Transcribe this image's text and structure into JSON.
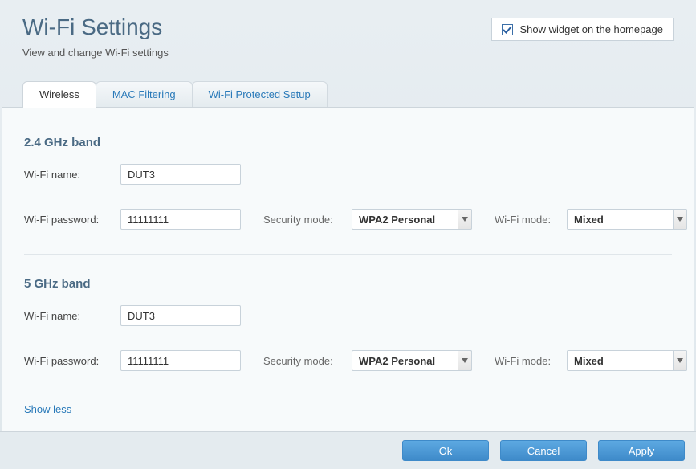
{
  "header": {
    "title": "Wi-Fi Settings",
    "subtitle": "View and change Wi-Fi settings",
    "widget_checkbox_label": "Show widget on the homepage",
    "widget_checked": true
  },
  "tabs": {
    "wireless": "Wireless",
    "mac_filtering": "MAC Filtering",
    "wps": "Wi-Fi Protected Setup"
  },
  "band24": {
    "title": "2.4 GHz band",
    "name_label": "Wi-Fi name:",
    "name_value": "DUT3",
    "password_label": "Wi-Fi password:",
    "password_value": "11111111",
    "security_label": "Security mode:",
    "security_value": "WPA2 Personal",
    "mode_label": "Wi-Fi mode:",
    "mode_value": "Mixed"
  },
  "band5": {
    "title": "5 GHz band",
    "name_label": "Wi-Fi name:",
    "name_value": "DUT3",
    "password_label": "Wi-Fi password:",
    "password_value": "11111111",
    "security_label": "Security mode:",
    "security_value": "WPA2 Personal",
    "mode_label": "Wi-Fi mode:",
    "mode_value": "Mixed"
  },
  "show_less": "Show less",
  "buttons": {
    "ok": "Ok",
    "cancel": "Cancel",
    "apply": "Apply"
  }
}
